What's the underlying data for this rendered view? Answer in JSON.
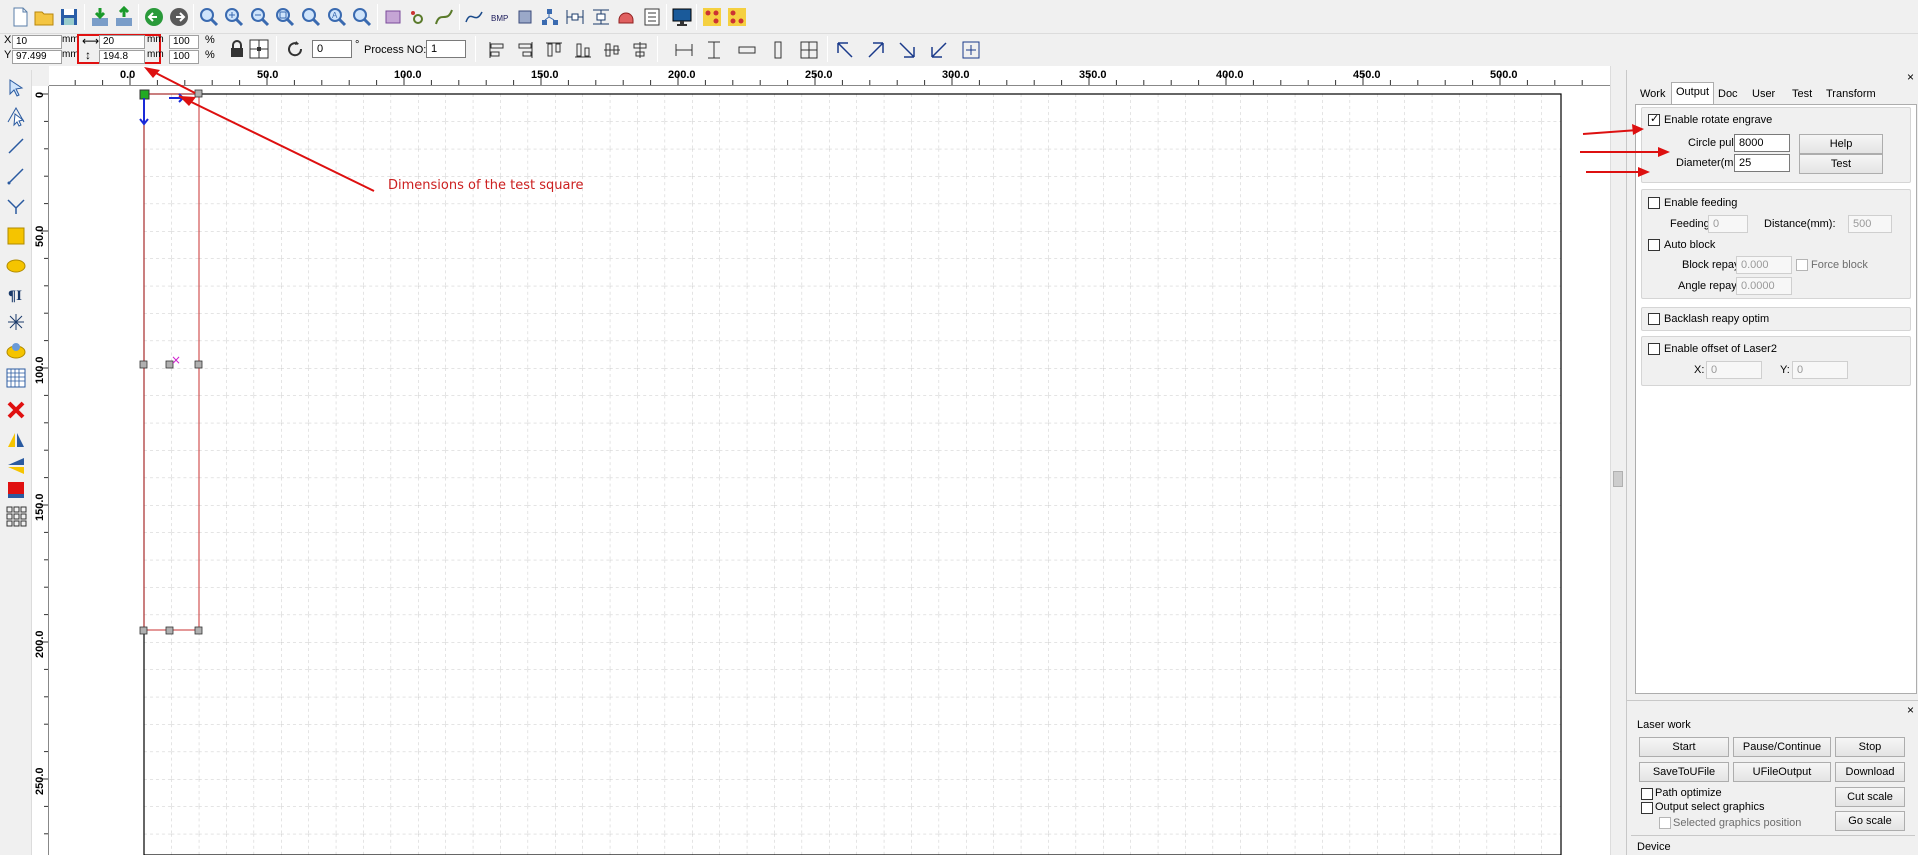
{
  "position_bar": {
    "x_label": "X",
    "x_value": "10",
    "x_unit": "mm",
    "y_label": "Y",
    "y_value": "97.499",
    "y_unit": "mm",
    "width_value": "20",
    "width_unit": "mm",
    "height_value": "194.8",
    "height_unit": "mm",
    "scale_x": "100",
    "scale_y": "100",
    "percent": "%",
    "rotate_value": "0",
    "degree": "°",
    "process_label": "Process NO:",
    "process_value": "1"
  },
  "hruler_labels": [
    "0.0",
    "50.0",
    "100.0",
    "150.0",
    "200.0",
    "250.0",
    "300.0",
    "350.0",
    "400.0",
    "450.0",
    "500.0"
  ],
  "vruler_labels": [
    "0",
    "50.0",
    "100.0",
    "150.0",
    "200.0",
    "250.0"
  ],
  "annotation": {
    "text": "Dimensions of the test square",
    "color": "#cc2020"
  },
  "tabs": [
    "Work",
    "Output",
    "Doc",
    "User",
    "Test",
    "Transform"
  ],
  "active_tab": "Output",
  "output": {
    "enable_rotate_engrave": "Enable rotate engrave",
    "circle_pulse_label": "Circle pulse:",
    "circle_pulse_value": "8000",
    "diameter_label": "Diameter(mm):",
    "diameter_value": "25",
    "help_btn": "Help",
    "test_btn": "Test",
    "enable_feeding": "Enable feeding",
    "feeding_label": "Feeding",
    "feeding_value": "0",
    "distance_label": "Distance(mm):",
    "distance_value": "500",
    "auto_block": "Auto block",
    "block_repay_label": "Block repay:",
    "block_repay_value": "0.000",
    "force_block": "Force block",
    "angle_repay_label": "Angle repay:",
    "angle_repay_value": "0.0000",
    "backlash": "Backlash reapy optim",
    "enable_offset": "Enable offset of Laser2",
    "x_label": "X:",
    "x_value": "0",
    "y_label": "Y:",
    "y_value": "0"
  },
  "laser_work": {
    "title": "Laser work",
    "start": "Start",
    "pause": "Pause/Continue",
    "stop": "Stop",
    "save": "SaveToUFile",
    "ufile": "UFileOutput",
    "download": "Download",
    "path_optimize": "Path optimize",
    "output_select": "Output select graphics",
    "selected_pos": "Selected graphics position",
    "cut_scale": "Cut scale",
    "go_scale": "Go scale",
    "device": "Device"
  },
  "close_symbol": "×",
  "colors": {
    "accent_red": "#dd1010",
    "shape_red": "#c83232",
    "grid": "#c8c8c8",
    "selection_magenta": "#d020d0"
  }
}
